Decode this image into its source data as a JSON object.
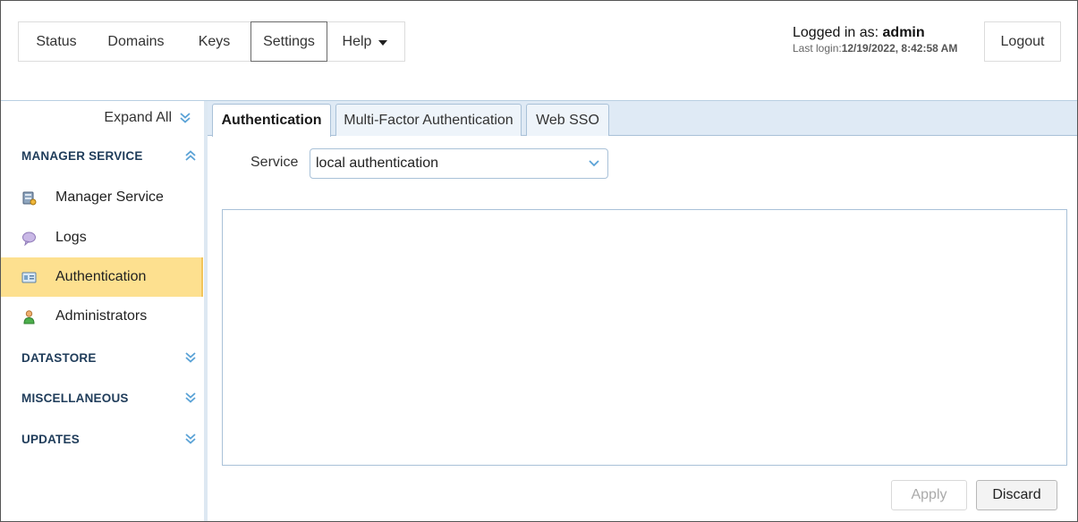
{
  "nav": {
    "items": [
      {
        "label": "Status"
      },
      {
        "label": "Domains"
      },
      {
        "label": "Keys"
      },
      {
        "label": "Settings"
      },
      {
        "label": "Help"
      }
    ],
    "selected": "Settings"
  },
  "user": {
    "logged_in_prefix": "Logged in as:",
    "username": "admin",
    "last_login_prefix": "Last login:",
    "last_login_value": "12/19/2022, 8:42:58 AM"
  },
  "logout_label": "Logout",
  "sidebar": {
    "expand_all": "Expand All",
    "sections": [
      {
        "title": "MANAGER SERVICE",
        "state": "expanded"
      },
      {
        "title": "DATASTORE",
        "state": "collapsed"
      },
      {
        "title": "MISCELLANEOUS",
        "state": "collapsed"
      },
      {
        "title": "UPDATES",
        "state": "collapsed"
      }
    ],
    "items": [
      {
        "label": "Manager Service",
        "icon": "server-icon"
      },
      {
        "label": "Logs",
        "icon": "log-bubble-icon"
      },
      {
        "label": "Authentication",
        "icon": "id-card-icon",
        "active": true
      },
      {
        "label": "Administrators",
        "icon": "user-icon"
      }
    ]
  },
  "tabs": [
    {
      "label": "Authentication",
      "active": true
    },
    {
      "label": "Multi-Factor Authentication"
    },
    {
      "label": "Web SSO"
    }
  ],
  "form": {
    "service_label": "Service",
    "service_value": "local authentication"
  },
  "buttons": {
    "apply": "Apply",
    "apply_disabled": true,
    "discard": "Discard"
  },
  "colors": {
    "active_item_bg": "#fde08f",
    "section_title": "#1f3c5a",
    "chevron": "#5aa2d6",
    "tabbar_bg": "#dfeaf5"
  }
}
